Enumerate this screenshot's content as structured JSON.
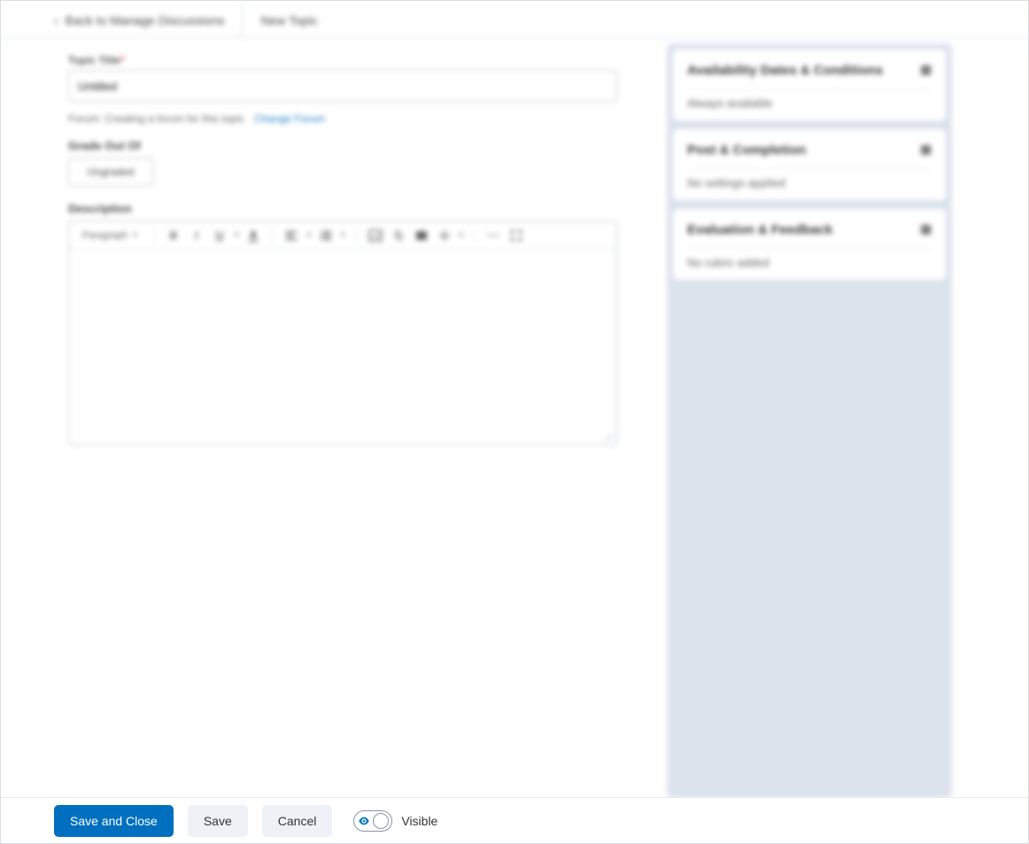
{
  "tabbar": {
    "back_label": "Back to Manage Discussions",
    "current_label": "New Topic"
  },
  "form": {
    "title_label": "Topic Title",
    "title_value": "Untitled",
    "forum_prefix": "Forum: Creating a forum for this topic",
    "change_forum_label": "Change Forum",
    "grade_label": "Grade Out Of",
    "ungraded_label": "Ungraded",
    "description_label": "Description",
    "editor_format_label": "Paragraph"
  },
  "sidebar": {
    "panels": [
      {
        "title": "Availability Dates & Conditions",
        "summary": "Always available"
      },
      {
        "title": "Post & Completion",
        "summary": "No settings applied"
      },
      {
        "title": "Evaluation & Feedback",
        "summary": "No rubric added"
      }
    ]
  },
  "footer": {
    "save_close_label": "Save and Close",
    "save_label": "Save",
    "cancel_label": "Cancel",
    "visibility_label": "Visible"
  }
}
